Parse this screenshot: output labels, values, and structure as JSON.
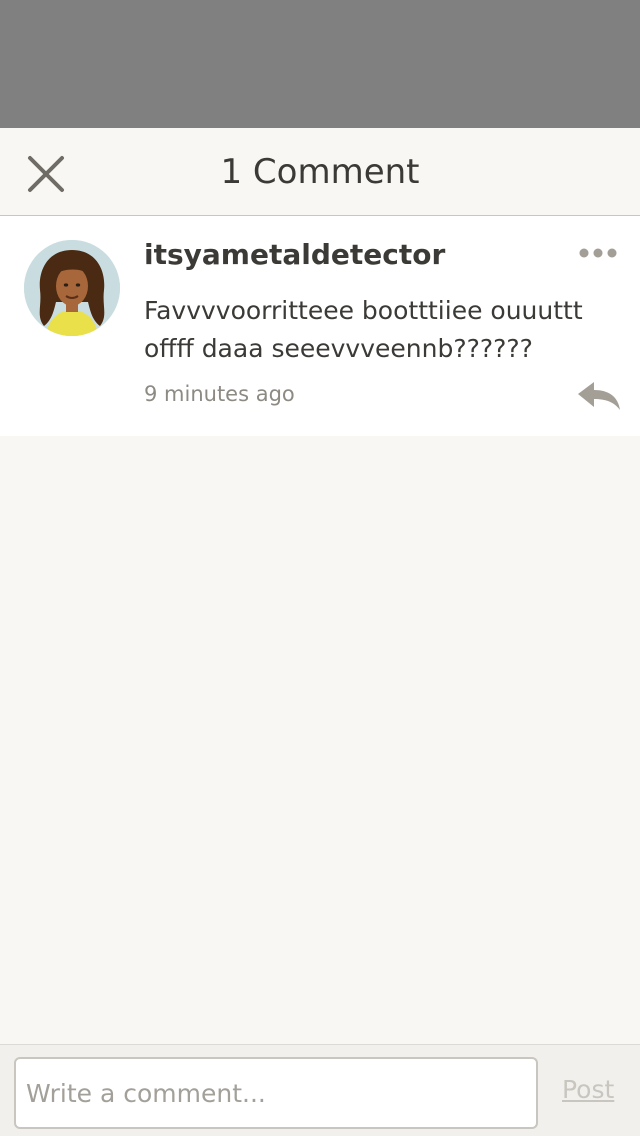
{
  "header": {
    "title": "1 Comment",
    "close_icon": "close-icon"
  },
  "comment": {
    "username": "itsyametaldetector",
    "text": "Favvvvoorritteee bootttiiee ouuuttt offff daaa seeevvveennb??????",
    "timestamp": "9 minutes ago",
    "avatar_icon": "avatar",
    "more_icon": "more-horizontal-icon",
    "reply_icon": "reply-icon"
  },
  "composer": {
    "placeholder": "Write a comment...",
    "value": "",
    "post_label": "Post"
  },
  "colors": {
    "overlay": "#808080",
    "background": "#f8f7f3",
    "icon": "#a39e96",
    "text": "#3b3a36",
    "muted": "#8d8a84"
  }
}
